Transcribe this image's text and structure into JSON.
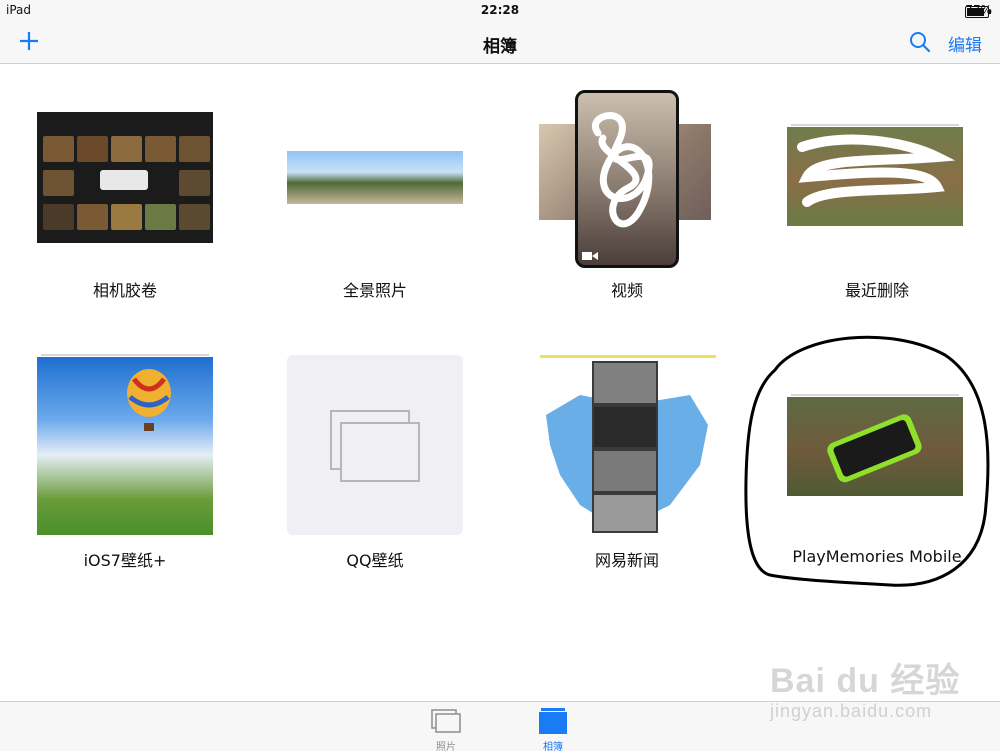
{
  "status_bar": {
    "device": "iPad",
    "time": "22:28",
    "battery": "77%"
  },
  "nav": {
    "title": "相簿",
    "edit_label": "编辑"
  },
  "albums": [
    {
      "name": "相机胶卷"
    },
    {
      "name": "全景照片"
    },
    {
      "name": "视频"
    },
    {
      "name": "最近删除"
    },
    {
      "name": "iOS7壁纸+"
    },
    {
      "name": "QQ壁纸"
    },
    {
      "name": "网易新闻"
    },
    {
      "name": "PlayMemories Mobile"
    }
  ],
  "tabs": [
    {
      "label": "照片",
      "selected": false
    },
    {
      "label": "相簿",
      "selected": true
    }
  ],
  "colors": {
    "accent": "#1a7cf5",
    "inactive_tab": "#8e8e93"
  },
  "watermark": {
    "brand": "Bai du 经验",
    "url": "jingyan.baidu.com"
  }
}
